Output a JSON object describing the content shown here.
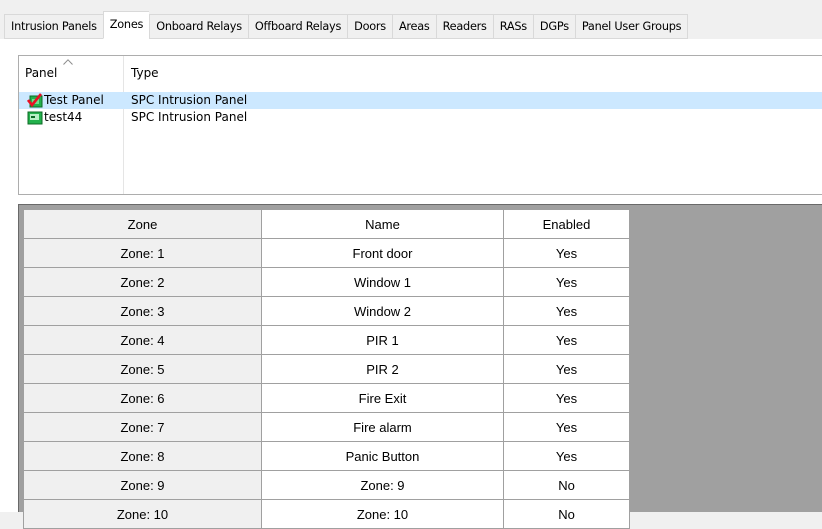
{
  "tabs": [
    {
      "label": "Intrusion Panels",
      "active": false
    },
    {
      "label": "Zones",
      "active": true
    },
    {
      "label": "Onboard Relays",
      "active": false
    },
    {
      "label": "Offboard Relays",
      "active": false
    },
    {
      "label": "Doors",
      "active": false
    },
    {
      "label": "Areas",
      "active": false
    },
    {
      "label": "Readers",
      "active": false
    },
    {
      "label": "RASs",
      "active": false
    },
    {
      "label": "DGPs",
      "active": false
    },
    {
      "label": "Panel User Groups",
      "active": false
    }
  ],
  "panels_list": {
    "columns": {
      "panel": "Panel",
      "type": "Type"
    },
    "sort_indicator": "sort-ascending-icon",
    "rows": [
      {
        "name": "Test Panel",
        "type": "SPC Intrusion Panel",
        "icon": "panel-checked-icon",
        "selected": true
      },
      {
        "name": "test44",
        "type": "SPC Intrusion Panel",
        "icon": "panel-icon",
        "selected": false
      }
    ]
  },
  "zones_grid": {
    "columns": {
      "zone": "Zone",
      "name": "Name",
      "enabled": "Enabled"
    },
    "rows": [
      {
        "zone": "Zone: 1",
        "name": "Front door",
        "enabled": "Yes"
      },
      {
        "zone": "Zone: 2",
        "name": "Window 1",
        "enabled": "Yes"
      },
      {
        "zone": "Zone: 3",
        "name": "Window 2",
        "enabled": "Yes"
      },
      {
        "zone": "Zone: 4",
        "name": "PIR 1",
        "enabled": "Yes"
      },
      {
        "zone": "Zone: 5",
        "name": "PIR 2",
        "enabled": "Yes"
      },
      {
        "zone": "Zone: 6",
        "name": "Fire Exit",
        "enabled": "Yes"
      },
      {
        "zone": "Zone: 7",
        "name": "Fire alarm",
        "enabled": "Yes"
      },
      {
        "zone": "Zone: 8",
        "name": "Panic Button",
        "enabled": "Yes"
      },
      {
        "zone": "Zone: 9",
        "name": "Zone: 9",
        "enabled": "No"
      },
      {
        "zone": "Zone: 10",
        "name": "Zone: 10",
        "enabled": "No"
      }
    ]
  },
  "colors": {
    "selection": "#cce8ff",
    "grid_background": "#a0a0a0",
    "panel_icon_green": "#22b14c",
    "check_red": "#e81123"
  }
}
